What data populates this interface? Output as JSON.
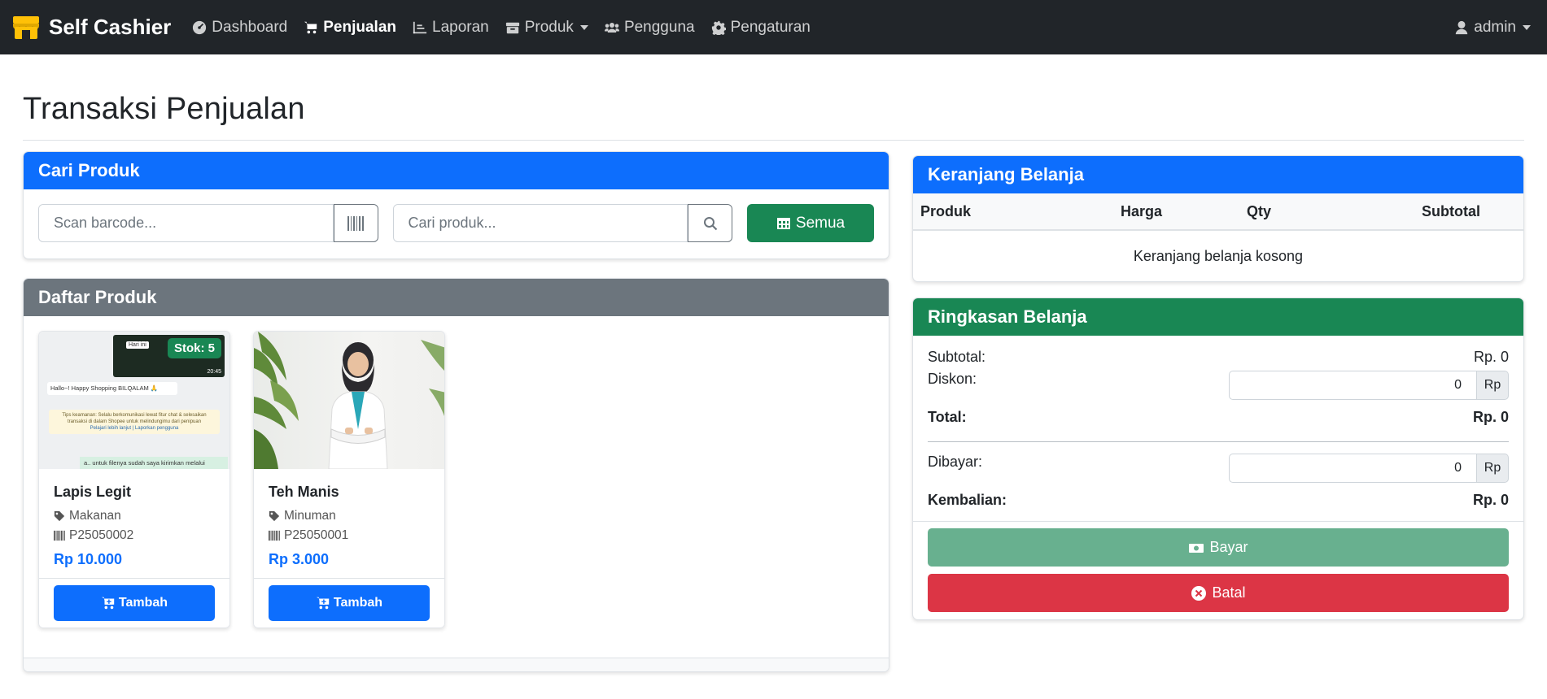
{
  "nav": {
    "brand": "Self Cashier",
    "items": [
      {
        "label": "Dashboard",
        "icon": "dashboard-icon"
      },
      {
        "label": "Penjualan",
        "icon": "cart-icon",
        "active": true
      },
      {
        "label": "Laporan",
        "icon": "chart-icon"
      },
      {
        "label": "Produk",
        "icon": "box-icon",
        "dropdown": true
      },
      {
        "label": "Pengguna",
        "icon": "users-icon"
      },
      {
        "label": "Pengaturan",
        "icon": "gear-icon"
      }
    ],
    "user": "admin"
  },
  "page": {
    "title": "Transaksi Penjualan"
  },
  "search": {
    "header": "Cari Produk",
    "barcode_placeholder": "Scan barcode...",
    "product_placeholder": "Cari produk...",
    "all_button": "Semua"
  },
  "products": {
    "header": "Daftar Produk",
    "items": [
      {
        "name": "Lapis Legit",
        "category": "Makanan",
        "code": "P25050002",
        "price": "Rp 10.000",
        "stock_badge": "Stok: 5",
        "add_label": "Tambah"
      },
      {
        "name": "Teh Manis",
        "category": "Minuman",
        "code": "P25050001",
        "price": "Rp 3.000",
        "add_label": "Tambah"
      }
    ],
    "chat_thumb": {
      "greeting": "Hallo~! Happy Shopping BILQALAM 🙏",
      "tip": "Tips keamanan: Selalu berkomunikasi lewat fitur chat & selesaikan transaksi di dalam Shopee untuk melindungimu dari penipuan",
      "links": "Pelajari lebih lanjut | Laporkan pengguna",
      "reply": "a.. untuk filenya sudah saya kirimkan melalui",
      "time": "20:45",
      "file_label": "Hari ini"
    }
  },
  "cart": {
    "header": "Keranjang Belanja",
    "columns": [
      "Produk",
      "Harga",
      "Qty",
      "Subtotal"
    ],
    "empty_text": "Keranjang belanja kosong"
  },
  "summary": {
    "header": "Ringkasan Belanja",
    "subtotal_label": "Subtotal:",
    "subtotal_value": "Rp. 0",
    "discount_label": "Diskon:",
    "discount_value": "0",
    "currency_unit": "Rp",
    "total_label": "Total:",
    "total_value": "Rp. 0",
    "paid_label": "Dibayar:",
    "paid_value": "0",
    "change_label": "Kembalian:",
    "change_value": "Rp. 0",
    "pay_button": "Bayar",
    "cancel_button": "Batal"
  },
  "colors": {
    "primary": "#0d6efd",
    "success": "#198754",
    "secondary": "#6c757d",
    "danger": "#dc3545",
    "navbar": "#212529"
  }
}
